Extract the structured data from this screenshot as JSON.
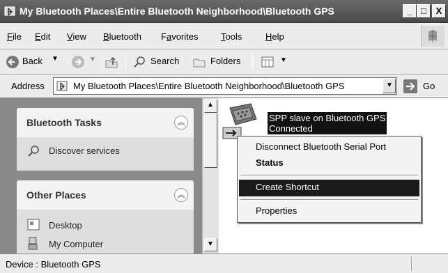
{
  "window": {
    "title": "My Bluetooth Places\\Entire Bluetooth Neighborhood\\Bluetooth GPS",
    "minimize_label": "_",
    "maximize_label": "□",
    "close_label": "X"
  },
  "menubar": {
    "items": [
      {
        "label": "File",
        "mnemonic": "F"
      },
      {
        "label": "Edit",
        "mnemonic": "E"
      },
      {
        "label": "View",
        "mnemonic": "V"
      },
      {
        "label": "Bluetooth",
        "mnemonic": "B"
      },
      {
        "label": "Favorites",
        "mnemonic": "a"
      },
      {
        "label": "Tools",
        "mnemonic": "T"
      },
      {
        "label": "Help",
        "mnemonic": "H"
      }
    ]
  },
  "toolbar": {
    "back_label": "Back",
    "search_label": "Search",
    "folders_label": "Folders"
  },
  "address": {
    "label": "Address",
    "value": "My Bluetooth Places\\Entire Bluetooth Neighborhood\\Bluetooth GPS",
    "go_label": "Go"
  },
  "leftpane": {
    "bluetooth_tasks": {
      "title": "Bluetooth Tasks",
      "items": [
        "Discover services"
      ]
    },
    "other_places": {
      "title": "Other Places",
      "items": [
        "Desktop",
        "My Computer"
      ]
    }
  },
  "content": {
    "device_name": "SPP slave on Bluetooth GPS",
    "device_status": "Connected"
  },
  "context_menu": {
    "items": [
      {
        "label": "Disconnect Bluetooth Serial Port"
      },
      {
        "label": "Status",
        "bold": true
      },
      {
        "label": "Create Shortcut",
        "highlighted": true
      },
      {
        "label": "Properties"
      }
    ]
  },
  "statusbar": {
    "text": "Device : Bluetooth GPS"
  }
}
